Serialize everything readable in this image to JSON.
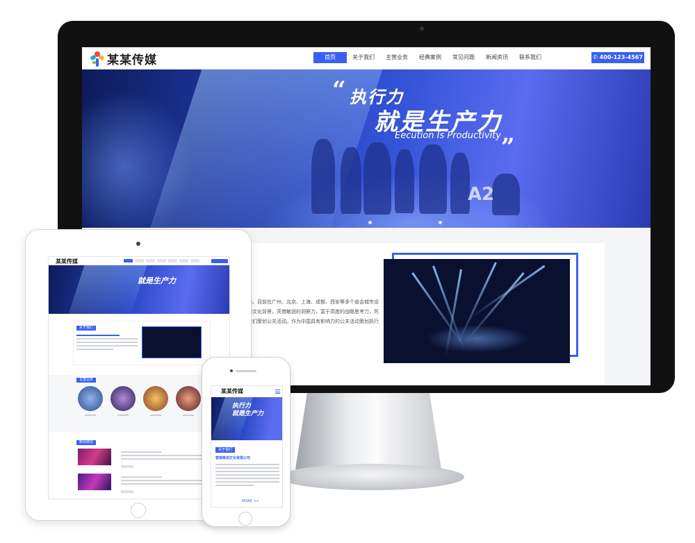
{
  "site": {
    "logo_text": "某某传媒",
    "nav": [
      "首页",
      "关于我们",
      "主营业务",
      "经典案例",
      "常见问题",
      "新闻资讯",
      "联系我们"
    ],
    "phone": "400-123-4567"
  },
  "banner": {
    "open_quote": "“",
    "slogan_line1": "执行力",
    "slogan_line2": "就是生产力",
    "slogan_en": "Eecution Is Productivity",
    "close_quote": "”",
    "stage_text": "A2"
  },
  "about": {
    "body_lines": [
      "州、目前在广州、北京、上海、成都、西安等多个省会城市设",
      "的文化背景，凭借敏锐的洞察力，富于高度的战略思考力，死",
      "旅们策划公关活动。作为中国具有影响力的公关活动策划执行"
    ]
  },
  "tablet": {
    "logo_text": "某某传媒",
    "slogan": "就是生产力",
    "about_title": "关于我们",
    "services_title": "主营业务",
    "news_title": "新闻资讯"
  },
  "phone": {
    "logo_text": "某某传媒",
    "slogan_line1": "执行力",
    "slogan_line2": "就是生产力",
    "about_title": "关于我们",
    "company_name": "营销策划文化有限公司",
    "more_label": "MORE >>"
  },
  "colors": {
    "accent": "#3a61ee",
    "bezel": "#111111"
  }
}
